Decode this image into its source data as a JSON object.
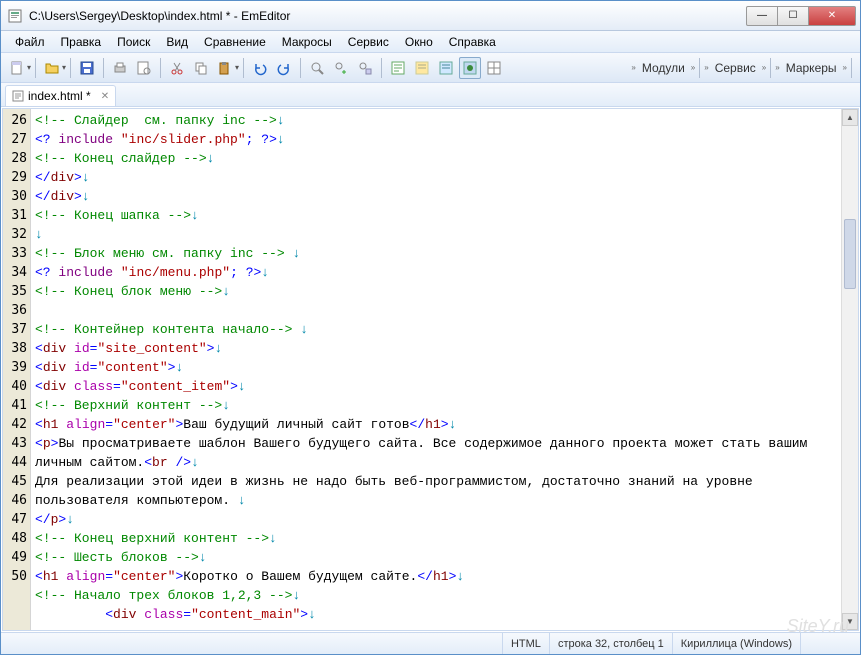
{
  "title": "C:\\Users\\Sergey\\Desktop\\index.html * - EmEditor",
  "menu": [
    "Файл",
    "Правка",
    "Поиск",
    "Вид",
    "Сравнение",
    "Макросы",
    "Сервис",
    "Окно",
    "Справка"
  ],
  "rightButtons": [
    "Модули",
    "Сервис",
    "Маркеры"
  ],
  "tab": {
    "label": "index.html *"
  },
  "statusbar": {
    "lang": "HTML",
    "pos": "строка 32, столбец 1",
    "encoding": "Кириллица (Windows)"
  },
  "watermark": "SiteY.ru",
  "lines": [
    {
      "n": 26,
      "tokens": [
        [
          "<!-- Слайдер  см. папку inc -->",
          "c-cmt"
        ],
        [
          "↓",
          "c-arrow"
        ]
      ]
    },
    {
      "n": 27,
      "tokens": [
        [
          "<?",
          "c-delim"
        ],
        [
          " ",
          ""
        ],
        [
          "include",
          "c-phpk"
        ],
        [
          " ",
          ""
        ],
        [
          "\"inc/slider.php\"",
          "c-str"
        ],
        [
          ";",
          "c-delim"
        ],
        [
          " ",
          ""
        ],
        [
          "?>",
          "c-delim"
        ],
        [
          "↓",
          "c-arrow"
        ]
      ]
    },
    {
      "n": 28,
      "tokens": [
        [
          "<!-- Конец слайдер -->",
          "c-cmt"
        ],
        [
          "↓",
          "c-arrow"
        ]
      ]
    },
    {
      "n": 29,
      "tokens": [
        [
          "</",
          "c-delim"
        ],
        [
          "div",
          "c-tag"
        ],
        [
          ">",
          "c-delim"
        ],
        [
          "↓",
          "c-arrow"
        ]
      ]
    },
    {
      "n": 30,
      "tokens": [
        [
          "</",
          "c-delim"
        ],
        [
          "div",
          "c-tag"
        ],
        [
          ">",
          "c-delim"
        ],
        [
          "↓",
          "c-arrow"
        ]
      ]
    },
    {
      "n": 31,
      "tokens": [
        [
          "<!-- Конец шапка -->",
          "c-cmt"
        ],
        [
          "↓",
          "c-arrow"
        ]
      ]
    },
    {
      "n": 32,
      "tokens": [
        [
          "↓",
          "c-arrow"
        ]
      ]
    },
    {
      "n": 33,
      "tokens": [
        [
          "<!-- Блок меню см. папку inc --> ",
          "c-cmt"
        ],
        [
          "↓",
          "c-arrow"
        ]
      ]
    },
    {
      "n": 34,
      "tokens": [
        [
          "<?",
          "c-delim"
        ],
        [
          " ",
          ""
        ],
        [
          "include",
          "c-phpk"
        ],
        [
          " ",
          ""
        ],
        [
          "\"inc/menu.php\"",
          "c-str"
        ],
        [
          ";",
          "c-delim"
        ],
        [
          " ",
          ""
        ],
        [
          "?>",
          "c-delim"
        ],
        [
          "↓",
          "c-arrow"
        ]
      ]
    },
    {
      "n": 35,
      "tokens": [
        [
          "<!-- Конец блок меню -->",
          "c-cmt"
        ],
        [
          "↓",
          "c-arrow"
        ]
      ]
    },
    {
      "n": 36,
      "tokens": []
    },
    {
      "n": 37,
      "tokens": [
        [
          "<!-- Контейнер контента начало--> ",
          "c-cmt"
        ],
        [
          "↓",
          "c-arrow"
        ]
      ]
    },
    {
      "n": 38,
      "tokens": [
        [
          "<",
          "c-delim"
        ],
        [
          "div",
          "c-tag"
        ],
        [
          " ",
          ""
        ],
        [
          "id",
          "c-attr"
        ],
        [
          "=",
          "c-delim"
        ],
        [
          "\"site_content\"",
          "c-str"
        ],
        [
          ">",
          "c-delim"
        ],
        [
          "↓",
          "c-arrow"
        ]
      ]
    },
    {
      "n": 39,
      "tokens": [
        [
          "<",
          "c-delim"
        ],
        [
          "div",
          "c-tag"
        ],
        [
          " ",
          ""
        ],
        [
          "id",
          "c-attr"
        ],
        [
          "=",
          "c-delim"
        ],
        [
          "\"content\"",
          "c-str"
        ],
        [
          ">",
          "c-delim"
        ],
        [
          "↓",
          "c-arrow"
        ]
      ]
    },
    {
      "n": 40,
      "tokens": [
        [
          "<",
          "c-delim"
        ],
        [
          "div",
          "c-tag"
        ],
        [
          " ",
          ""
        ],
        [
          "class",
          "c-attr"
        ],
        [
          "=",
          "c-delim"
        ],
        [
          "\"content_item\"",
          "c-str"
        ],
        [
          ">",
          "c-delim"
        ],
        [
          "↓",
          "c-arrow"
        ]
      ]
    },
    {
      "n": 41,
      "tokens": [
        [
          "<!-- Верхний контент -->",
          "c-cmt"
        ],
        [
          "↓",
          "c-arrow"
        ]
      ]
    },
    {
      "n": 42,
      "tokens": [
        [
          "<",
          "c-delim"
        ],
        [
          "h1",
          "c-tag"
        ],
        [
          " ",
          ""
        ],
        [
          "align",
          "c-attr"
        ],
        [
          "=",
          "c-delim"
        ],
        [
          "\"center\"",
          "c-str"
        ],
        [
          ">",
          "c-delim"
        ],
        [
          "Ваш будущий личный сайт готов",
          "c-text"
        ],
        [
          "</",
          "c-delim"
        ],
        [
          "h1",
          "c-tag"
        ],
        [
          ">",
          "c-delim"
        ],
        [
          "↓",
          "c-arrow"
        ]
      ]
    },
    {
      "n": 43,
      "wrap": true,
      "tokens": [
        [
          "<",
          "c-delim"
        ],
        [
          "p",
          "c-tag"
        ],
        [
          ">",
          "c-delim"
        ],
        [
          "Вы просматриваете шаблон Вашего будущего сайта. Все содержимое данного проекта может стать вашим личным сайтом.",
          "c-text"
        ],
        [
          "<",
          "c-delim"
        ],
        [
          "br",
          "c-tag"
        ],
        [
          " ",
          ""
        ],
        [
          "/>",
          "c-delim"
        ],
        [
          "↓",
          "c-arrow"
        ]
      ]
    },
    {
      "n": 44,
      "wrap": true,
      "tokens": [
        [
          "Для реализации этой идеи в жизнь не надо быть веб-программистом, достаточно знаний на уровне пользователя компьютером. ",
          "c-text"
        ],
        [
          "↓",
          "c-arrow"
        ]
      ]
    },
    {
      "n": 45,
      "tokens": [
        [
          "</",
          "c-delim"
        ],
        [
          "p",
          "c-tag"
        ],
        [
          ">",
          "c-delim"
        ],
        [
          "↓",
          "c-arrow"
        ]
      ]
    },
    {
      "n": 46,
      "tokens": [
        [
          "<!-- Конец верхний контент -->",
          "c-cmt"
        ],
        [
          "↓",
          "c-arrow"
        ]
      ]
    },
    {
      "n": 47,
      "tokens": [
        [
          "<!-- Шесть блоков -->",
          "c-cmt"
        ],
        [
          "↓",
          "c-arrow"
        ]
      ]
    },
    {
      "n": 48,
      "tokens": [
        [
          "<",
          "c-delim"
        ],
        [
          "h1",
          "c-tag"
        ],
        [
          " ",
          ""
        ],
        [
          "align",
          "c-attr"
        ],
        [
          "=",
          "c-delim"
        ],
        [
          "\"center\"",
          "c-str"
        ],
        [
          ">",
          "c-delim"
        ],
        [
          "Коротко о Вашем будущем сайте.",
          "c-text"
        ],
        [
          "</",
          "c-delim"
        ],
        [
          "h1",
          "c-tag"
        ],
        [
          ">",
          "c-delim"
        ],
        [
          "↓",
          "c-arrow"
        ]
      ]
    },
    {
      "n": 49,
      "tokens": [
        [
          "<!-- Начало трех блоков 1,2,3 -->",
          "c-cmt"
        ],
        [
          "↓",
          "c-arrow"
        ]
      ]
    },
    {
      "n": 50,
      "tokens": [
        [
          "         ",
          ""
        ],
        [
          "<",
          "c-delim"
        ],
        [
          "div",
          "c-tag"
        ],
        [
          " ",
          ""
        ],
        [
          "class",
          "c-attr"
        ],
        [
          "=",
          "c-delim"
        ],
        [
          "\"content_main\"",
          "c-str"
        ],
        [
          ">",
          "c-delim"
        ],
        [
          "↓",
          "c-arrow"
        ]
      ]
    }
  ]
}
